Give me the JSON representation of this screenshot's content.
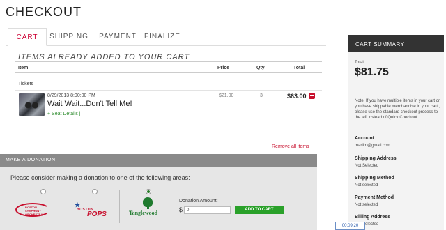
{
  "page": {
    "title": "CHECKOUT"
  },
  "tabs": [
    {
      "label": "CART",
      "active": true
    },
    {
      "label": "SHIPPING",
      "active": false
    },
    {
      "label": "PAYMENT",
      "active": false
    },
    {
      "label": "FINALIZE",
      "active": false
    }
  ],
  "cart": {
    "heading": "ITEMS ALREADY ADDED TO YOUR CART",
    "columns": {
      "item": "Item",
      "price": "Price",
      "qty": "Qty",
      "total": "Total"
    },
    "category": "Tickets",
    "items": [
      {
        "date": "8/29/2013 8:00:00 PM",
        "name": "Wait Wait...Don't Tell Me!",
        "seat_details": "+ Seat Details |",
        "price": "$21.00",
        "qty": "3",
        "total": "$63.00",
        "remove_icon": "minus-icon"
      }
    ],
    "remove_all": "Remove all items"
  },
  "donation": {
    "heading": "MAKE A DONATION.",
    "prompt": "Please consider making a donation to one of the following areas:",
    "options": [
      {
        "org_logo_text": [
          "BOSTON",
          "SYMPHONY",
          "ORCHESTRA"
        ],
        "selected": false
      },
      {
        "org_logo_text": [
          "BOSTON",
          "POPS"
        ],
        "selected": false
      },
      {
        "org_logo_text": [
          "Tanglewood"
        ],
        "selected": true
      }
    ],
    "amount_label": "Donation Amount:",
    "currency": "$",
    "amount_value": "0",
    "add_button": "ADD TO CART"
  },
  "summary": {
    "heading": "CART SUMMARY",
    "total_label": "Total",
    "total_value": "$81.75",
    "note": "Note: If you have multiple items in your cart or you have shippable merchandise in your cart , please use the standard checkout process to the left instead of Quick Checkout.",
    "account_label": "Account",
    "account_value": "marlim@gmail.com",
    "shipping_address_label": "Shipping Address",
    "shipping_address_value": "Not Selected",
    "shipping_method_label": "Shipping Method",
    "shipping_method_value": "Not selected",
    "payment_method_label": "Payment Method",
    "payment_method_value": "Not selected",
    "billing_address_label": "Billing Address",
    "billing_address_value": "Not Selected"
  },
  "timer": "00:09:20",
  "colors": {
    "accent_red": "#c8102e",
    "green": "#2aa12a",
    "summary_header": "#333333"
  }
}
